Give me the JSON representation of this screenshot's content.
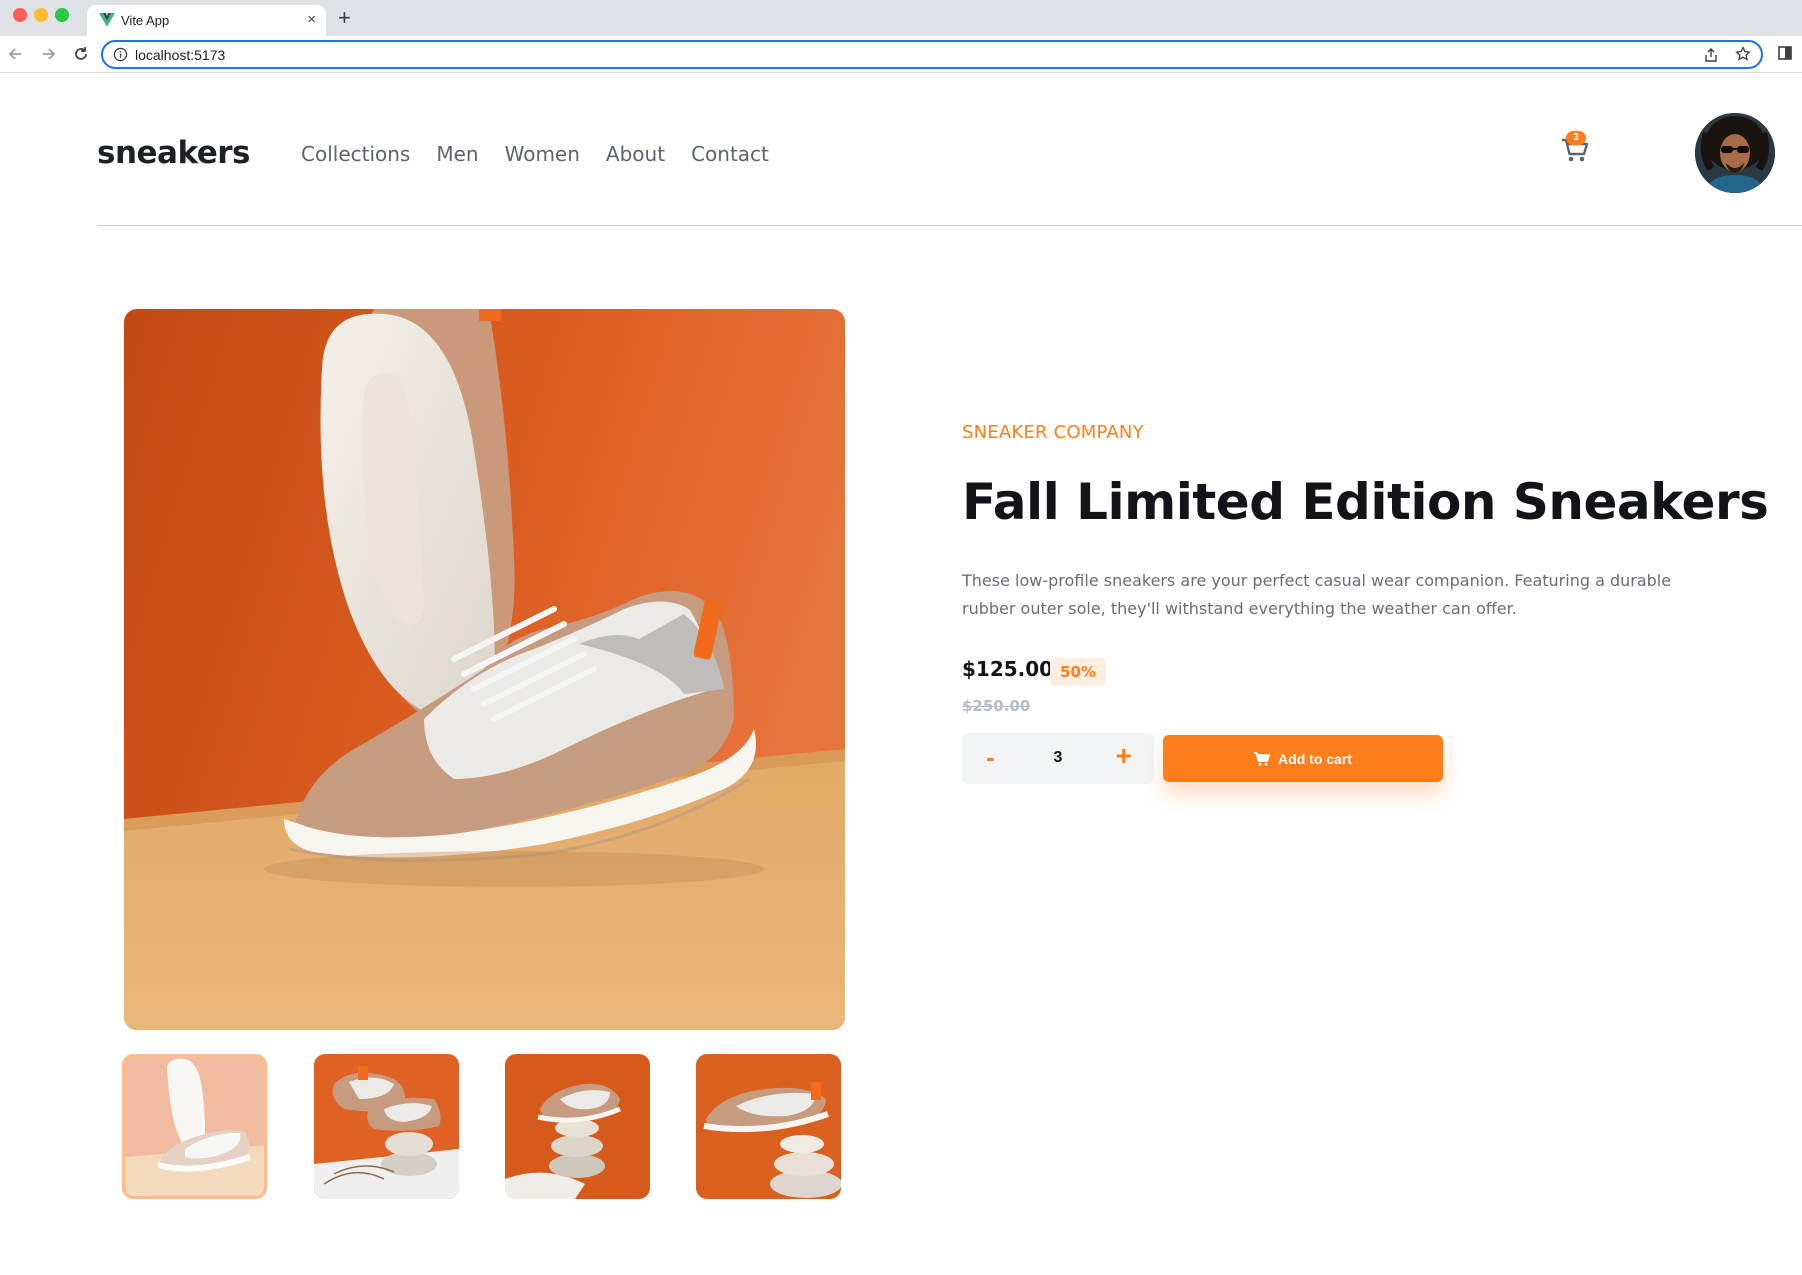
{
  "browser": {
    "tab_title": "Vite App",
    "url": "localhost:5173",
    "close_tab_symbol": "×",
    "new_tab_symbol": "+"
  },
  "header": {
    "logo": "sneakers",
    "nav": [
      "Collections",
      "Men",
      "Women",
      "About",
      "Contact"
    ],
    "cart_count": "3"
  },
  "product": {
    "company": "SNEAKER COMPANY",
    "title": "Fall Limited Edition Sneakers",
    "description": "These low-profile sneakers are your perfect casual wear companion. Featuring a durable rubber outer sole, they'll withstand everything the weather can offer.",
    "price": "$125.00",
    "discount": "50%",
    "old_price": "$250.00"
  },
  "quantity": {
    "minus": "-",
    "value": "3",
    "plus": "+"
  },
  "add_to_cart_label": "Add to cart",
  "gallery": {
    "thumbnails": [
      "image-product-1",
      "image-product-2",
      "image-product-3",
      "image-product-4"
    ],
    "selected_index": 0
  },
  "colors": {
    "accent": "#ff7d1a",
    "accent_light": "#ffede0",
    "dark": "#12141a",
    "text_muted": "#686d77"
  },
  "icons": {
    "cart": "cart-icon",
    "add_cart": "cart-icon",
    "back": "arrow-left-icon",
    "forward": "arrow-right-icon",
    "reload": "reload-icon",
    "info": "info-icon",
    "share": "share-icon",
    "bookmark": "star-icon"
  }
}
